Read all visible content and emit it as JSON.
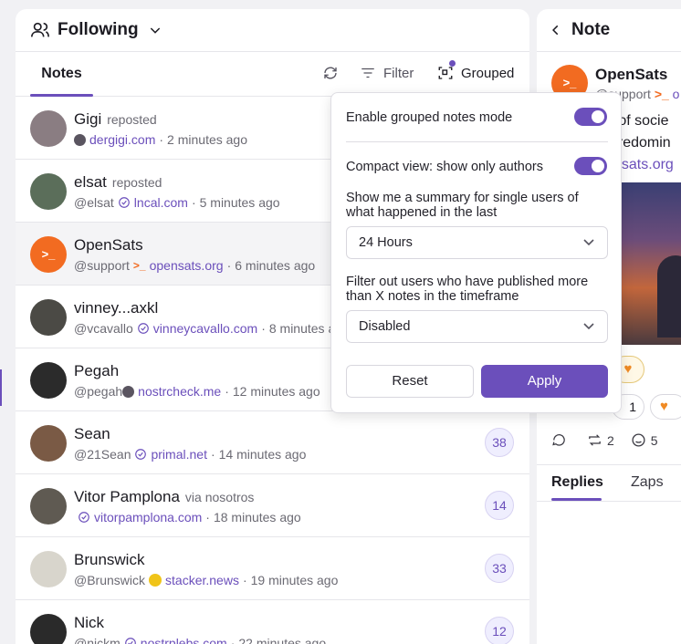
{
  "feed": {
    "title": "Following",
    "tab": "Notes",
    "refresh_icon": "refresh-icon",
    "filter_label": "Filter",
    "grouped_label": "Grouped"
  },
  "notes": [
    {
      "name": "Gigi",
      "action": "reposted",
      "handle": "",
      "domain": "dergigi.com",
      "time": "2 minutes ago",
      "avatar_color": "#8a7d82",
      "badge": ""
    },
    {
      "name": "elsat",
      "action": "reposted",
      "handle": "@elsat",
      "domain": "lncal.com",
      "time": "5 minutes ago",
      "avatar_color": "#5b6e5a",
      "badge": ""
    },
    {
      "name": "OpenSats",
      "action": "",
      "handle": "@support",
      "domain": "opensats.org",
      "time": "6 minutes ago",
      "avatar_color": "#f26b21",
      "badge": ""
    },
    {
      "name": "vinney...axkl",
      "action": "",
      "handle": "@vcavallo",
      "domain": "vinneycavallo.com",
      "time": "8 minutes ago",
      "avatar_color": "#4b4a45",
      "badge": ""
    },
    {
      "name": "Pegah",
      "action": "",
      "handle": "@pegah",
      "domain": "nostrcheck.me",
      "time": "12 minutes ago",
      "avatar_color": "#2b2b2b",
      "badge": ""
    },
    {
      "name": "Sean",
      "action": "",
      "handle": "@21Sean",
      "domain": "primal.net",
      "time": "14 minutes ago",
      "avatar_color": "#7a5a45",
      "badge": "38"
    },
    {
      "name": "Vitor Pamplona",
      "action": "via nosotros",
      "handle": "",
      "domain": "vitorpamplona.com",
      "time": "18 minutes ago",
      "avatar_color": "#5f5a52",
      "badge": "14"
    },
    {
      "name": "Brunswick",
      "action": "",
      "handle": "@Brunswick",
      "domain": "stacker.news",
      "time": "19 minutes ago",
      "avatar_color": "#d8d5cc",
      "badge": "33"
    },
    {
      "name": "Nick",
      "action": "",
      "handle": "@nickm",
      "domain": "nostrplebs.com",
      "time": "22 minutes ago",
      "avatar_color": "#2a2a2a",
      "badge": "12"
    }
  ],
  "popup": {
    "grouped_mode_label": "Enable grouped notes mode",
    "compact_label": "Compact view: show only authors",
    "summary_label": "Show me a summary for single users of what happened in the last",
    "summary_value": "24 Hours",
    "filter_label": "Filter out users who have published more than X notes in the timeframe",
    "filter_value": "Disabled",
    "reset": "Reset",
    "apply": "Apply",
    "grouped_on": true,
    "compact_on": true
  },
  "note_panel": {
    "title": "Note",
    "author": "OpenSats",
    "handle": "@support",
    "domain_part": "o",
    "text_line1": "e of socie",
    "text_line2": "predomin",
    "link_part": "nsats.org",
    "reaction_count_1": "1",
    "repost_count": "2",
    "reaction_count_2": "5",
    "tab_replies": "Replies",
    "tab_zaps": "Zaps"
  },
  "colors": {
    "accent": "#6b4fbb",
    "orange": "#f26b21"
  }
}
